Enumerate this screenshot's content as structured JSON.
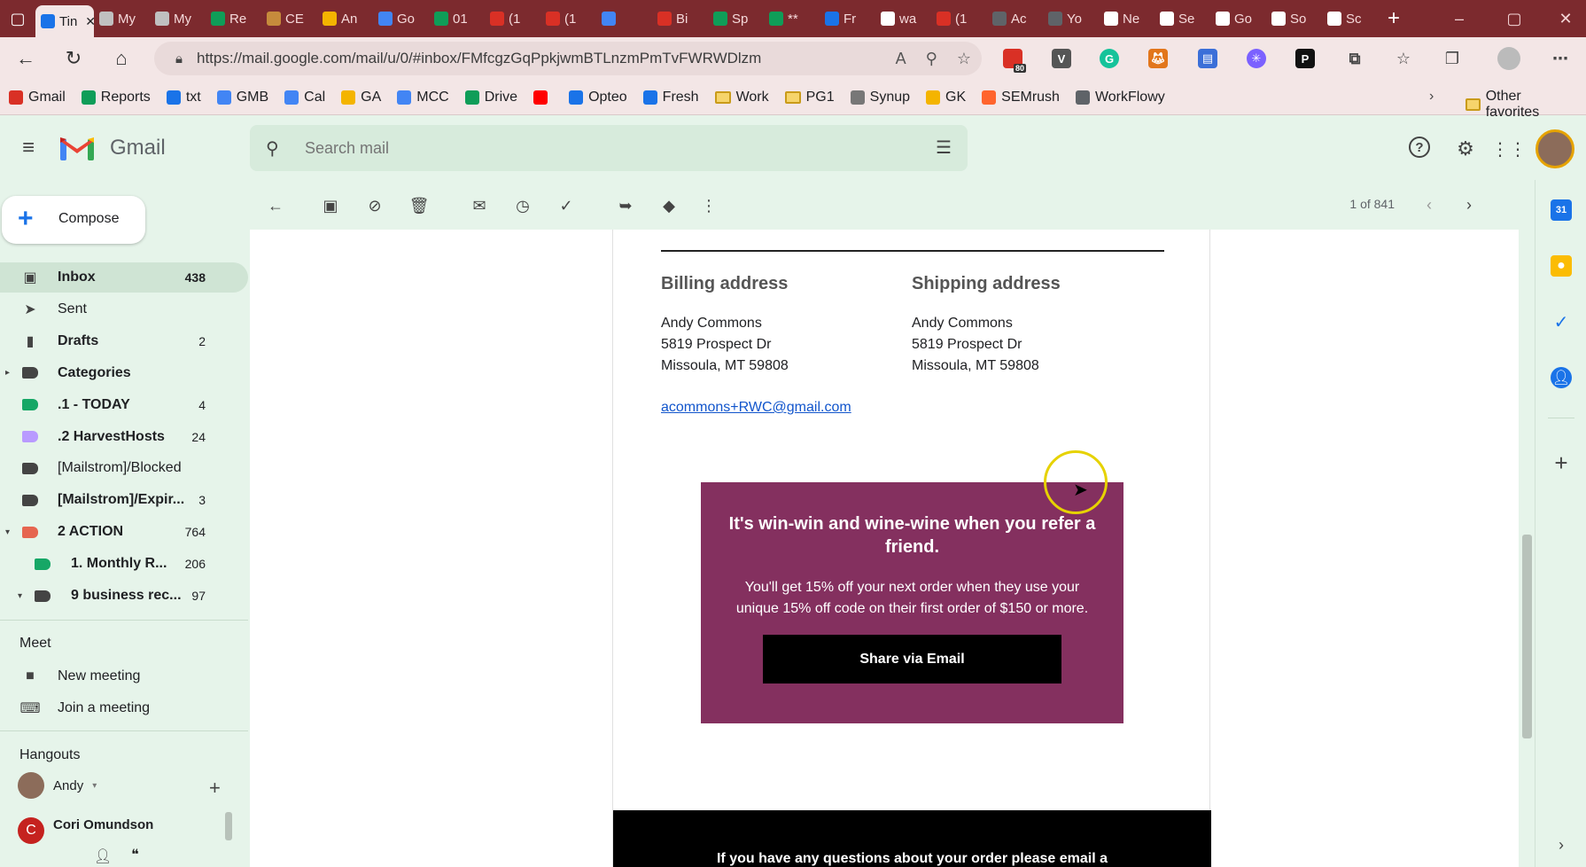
{
  "browser": {
    "tabs": [
      {
        "label": "Tin",
        "color": "#1a73e8",
        "active": true
      },
      {
        "label": "My",
        "color": "#c0c0c0"
      },
      {
        "label": "My",
        "color": "#c0c0c0"
      },
      {
        "label": "Re",
        "color": "#0f9d58"
      },
      {
        "label": "CE",
        "color": "#c68b3c"
      },
      {
        "label": "An",
        "color": "#f4b400"
      },
      {
        "label": "Go",
        "color": "#4285f4"
      },
      {
        "label": "01",
        "color": "#0f9d58"
      },
      {
        "label": "(1",
        "color": "#d93025"
      },
      {
        "label": "(1",
        "color": "#d93025"
      },
      {
        "label": "",
        "color": "#4285f4"
      },
      {
        "label": "Bi",
        "color": "#d93025"
      },
      {
        "label": "Sp",
        "color": "#0f9d58"
      },
      {
        "label": "**",
        "color": "#0f9d58"
      },
      {
        "label": "Fr",
        "color": "#1a73e8"
      },
      {
        "label": "wa",
        "color": "#ffffff"
      },
      {
        "label": "(1",
        "color": "#d93025"
      },
      {
        "label": "Ac",
        "color": "#5f6368"
      },
      {
        "label": "Yo",
        "color": "#5f6368"
      },
      {
        "label": "Ne",
        "color": "#ffffff"
      },
      {
        "label": "Se",
        "color": "#ffffff"
      },
      {
        "label": "Go",
        "color": "#ffffff"
      },
      {
        "label": "So",
        "color": "#ffffff"
      },
      {
        "label": "Sc",
        "color": "#ffffff"
      }
    ],
    "url": "https://mail.google.com/mail/u/0/#inbox/FMfcgzGqPpkjwmBTLnzmPmTvFWRWDlzm",
    "ext_badge": "80",
    "bookmarks": [
      {
        "label": "Gmail",
        "color": "#d93025"
      },
      {
        "label": "Reports",
        "color": "#0f9d58"
      },
      {
        "label": "txt",
        "color": "#1a73e8"
      },
      {
        "label": "GMB",
        "color": "#4285f4"
      },
      {
        "label": "Cal",
        "color": "#4285f4"
      },
      {
        "label": "GA",
        "color": "#f4b400"
      },
      {
        "label": "MCC",
        "color": "#4285f4"
      },
      {
        "label": "Drive",
        "color": "#0f9d58"
      },
      {
        "label": "",
        "color": "#ff0000"
      },
      {
        "label": "Opteo",
        "color": "#1a73e8"
      },
      {
        "label": "Fresh",
        "color": "#1a73e8"
      },
      {
        "label": "Work",
        "color": "folder"
      },
      {
        "label": "PG1",
        "color": "folder"
      },
      {
        "label": "Synup",
        "color": "#777777"
      },
      {
        "label": "GK",
        "color": "#f4b400"
      },
      {
        "label": "SEMrush",
        "color": "#ff642d"
      },
      {
        "label": "WorkFlowy",
        "color": "#5f6368"
      }
    ],
    "other_favorites": "Other favorites"
  },
  "gmail": {
    "app_name": "Gmail",
    "search_placeholder": "Search mail",
    "compose": "Compose",
    "nav": [
      {
        "label": "Inbox",
        "count": "438",
        "bold": true,
        "active": true,
        "icon": "inbox-icon"
      },
      {
        "label": "Sent",
        "count": "",
        "bold": false,
        "icon": "send-icon"
      },
      {
        "label": "Drafts",
        "count": "2",
        "bold": true,
        "icon": "draft-icon"
      },
      {
        "label": "Categories",
        "count": "",
        "bold": true,
        "icon": "label-icon",
        "color": "#444444",
        "caret": "▸"
      },
      {
        "label": ".1 - TODAY",
        "count": "4",
        "bold": true,
        "icon": "label-icon",
        "color": "#16a766"
      },
      {
        "label": ".2 HarvestHosts",
        "count": "24",
        "bold": true,
        "icon": "label-icon",
        "color": "#b99aff"
      },
      {
        "label": "[Mailstrom]/Blocked",
        "count": "",
        "bold": false,
        "icon": "label-icon",
        "color": "#444444"
      },
      {
        "label": "[Mailstrom]/Expir...",
        "count": "3",
        "bold": true,
        "icon": "label-icon",
        "color": "#444444"
      },
      {
        "label": "2 ACTION",
        "count": "764",
        "bold": true,
        "icon": "label-icon",
        "color": "#e66550",
        "caret": "▾"
      },
      {
        "label": "1. Monthly R...",
        "count": "206",
        "bold": true,
        "icon": "label-icon",
        "color": "#16a766",
        "indent": true
      },
      {
        "label": "9 business rec...",
        "count": "97",
        "bold": true,
        "icon": "label-icon",
        "color": "#444444",
        "caret": "▾",
        "indent": true
      }
    ],
    "meet": {
      "title": "Meet",
      "new_meeting": "New meeting",
      "join_meeting": "Join a meeting"
    },
    "hangouts": {
      "title": "Hangouts",
      "me": "Andy",
      "contact": "Cori Omundson",
      "contact_initial": "C"
    },
    "pager": "1 of 841"
  },
  "email": {
    "billing_title": "Billing address",
    "shipping_title": "Shipping address",
    "billing": [
      "Andy Commons",
      "5819 Prospect Dr",
      "Missoula, MT 59808"
    ],
    "shipping": [
      "Andy Commons",
      "5819 Prospect Dr",
      "Missoula, MT 59808"
    ],
    "email_link": "acommons+RWC@gmail.com",
    "promo_heading": "It's win-win and wine-wine when you refer a friend.",
    "promo_body": "You'll get 15% off your next order when they use your unique 15% off code on their first order of $150 or more.",
    "share_button": "Share via Email",
    "footer_text": "If you have any questions about your order please email a"
  }
}
